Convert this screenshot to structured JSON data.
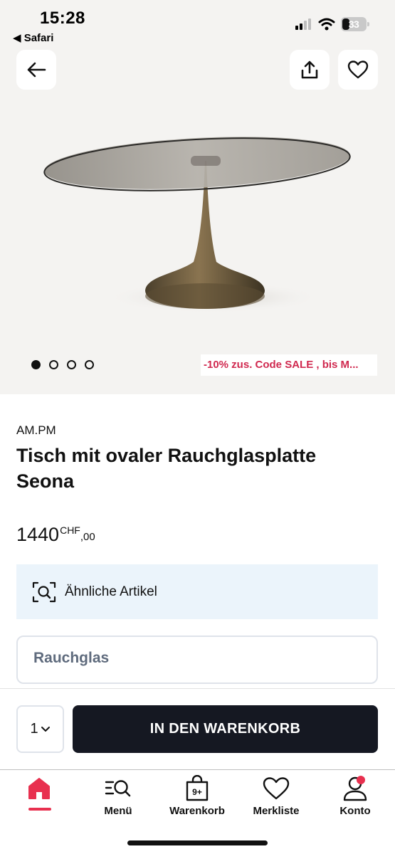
{
  "status_bar": {
    "time": "15:28",
    "back_app": "◀ Safari",
    "battery": "33",
    "icons": [
      "signal-icon",
      "wifi-icon",
      "battery-icon"
    ]
  },
  "hero": {
    "promo": "-10% zus. Code SALE , bis M...",
    "carousel_dots": 4,
    "active_dot": 1,
    "icons": [
      "arrow-left-icon",
      "share-icon",
      "heart-icon"
    ]
  },
  "product": {
    "brand": "AM.PM",
    "title": "Tisch mit ovaler Rauchglasplatte Seona",
    "price_main": "1440",
    "price_currency": "CHF",
    "price_decimals": ",00"
  },
  "similar": {
    "label": "Ähnliche Artikel",
    "icon": "image-search-icon"
  },
  "variant": {
    "value": "Rauchglas"
  },
  "purchase": {
    "quantity": "1",
    "cart_label": "IN DEN WARENKORB"
  },
  "nav": {
    "items": [
      {
        "label": "",
        "icon": "home-icon"
      },
      {
        "label": "Menü",
        "icon": "menu-search-icon"
      },
      {
        "label": "Warenkorb",
        "icon": "shopping-bag-icon",
        "badge": "9+"
      },
      {
        "label": "Merkliste",
        "icon": "heart-icon"
      },
      {
        "label": "Konto",
        "icon": "user-icon"
      }
    ]
  },
  "colors": {
    "accent": "#e8304f",
    "promo": "#d0294f",
    "button_dark": "#151822",
    "info_bg": "#ebf4fb"
  }
}
